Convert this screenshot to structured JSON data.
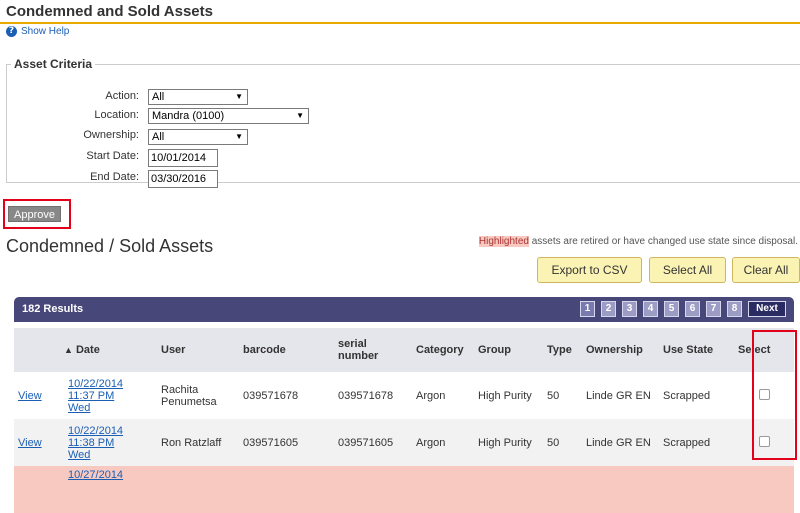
{
  "page": {
    "title": "Condemned and Sold Assets",
    "help_label": "Show Help"
  },
  "criteria": {
    "legend": "Asset Criteria",
    "action_label": "Action:",
    "action_value": "All",
    "location_label": "Location:",
    "location_value": "Mandra (0100)",
    "ownership_label": "Ownership:",
    "ownership_value": "All",
    "start_label": "Start Date:",
    "start_value": "10/01/2014",
    "end_label": "End Date:",
    "end_value": "03/30/2016"
  },
  "approve_label": "Approve",
  "section": {
    "title": "Condemned / Sold Assets",
    "note_highlight": "Highlighted",
    "note_text": " assets are retired or have changed use state since disposal."
  },
  "buttons": {
    "export": "Export to CSV",
    "select_all": "Select All",
    "clear_all": "Clear All"
  },
  "results": {
    "count_label": "182 Results",
    "pages": [
      "1",
      "2",
      "3",
      "4",
      "5",
      "6",
      "7",
      "8"
    ],
    "current_page": "1",
    "next_label": "Next"
  },
  "table": {
    "columns": [
      "",
      "Date",
      "User",
      "barcode",
      "serial number",
      "Category",
      "Group",
      "Type",
      "Ownership",
      "Use State",
      "Select"
    ],
    "sort_column": "Date",
    "rows": [
      {
        "view": "View",
        "date1": "10/22/2014",
        "date2": "11:37 PM",
        "date3": "Wed",
        "user": "Rachita Penumetsa",
        "barcode": "039571678",
        "serial": "039571678",
        "category": "Argon",
        "group": "High Purity",
        "type": "50",
        "ownership": "Linde GR EN",
        "use_state": "Scrapped",
        "selected": false,
        "highlighted": false
      },
      {
        "view": "View",
        "date1": "10/22/2014",
        "date2": "11:38 PM",
        "date3": "Wed",
        "user": "Ron Ratzlaff",
        "barcode": "039571605",
        "serial": "039571605",
        "category": "Argon",
        "group": "High Purity",
        "type": "50",
        "ownership": "Linde GR EN",
        "use_state": "Scrapped",
        "selected": false,
        "highlighted": false
      },
      {
        "view": "",
        "date1": "10/27/2014",
        "date2": "",
        "date3": "",
        "user": "",
        "barcode": "",
        "serial": "",
        "category": "",
        "group": "",
        "type": "",
        "ownership": "",
        "use_state": "",
        "selected": false,
        "highlighted": true
      }
    ]
  },
  "colors": {
    "accent": "#e8a900",
    "results_bar": "#47477a",
    "highlight_row": "#f8c9c1",
    "link": "#1b5fb5",
    "annotation_box": "#e3001b"
  },
  "icons": {
    "help": "help-icon",
    "dropdown": "chevron-down-icon",
    "sort": "sort-ascending-icon"
  }
}
